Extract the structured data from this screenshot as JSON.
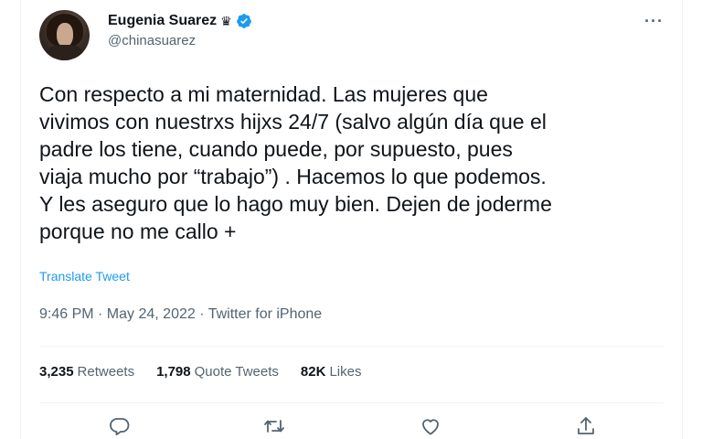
{
  "author": {
    "display_name": "Eugenia Suarez",
    "badge_glyph": "♛",
    "handle": "@chinasuarez"
  },
  "menu": {
    "more_glyph": "···"
  },
  "tweet": {
    "text": "Con respecto a mi maternidad. Las mujeres que\nvivimos con nuestrxs hijxs 24/7 (salvo algún día que el\npadre los tiene, cuando puede, por supuesto, pues\nviaja mucho por “trabajo”) . Hacemos lo que podemos.\nY les aseguro que lo hago muy bien. Dejen de joderme\nporque no me callo +",
    "translate_label": "Translate Tweet",
    "timestamp": "9:46 PM · May 24, 2022 · Twitter for iPhone"
  },
  "stats": {
    "retweets": {
      "count": "3,235",
      "label": "Retweets"
    },
    "quote_tweets": {
      "count": "1,798",
      "label": "Quote Tweets"
    },
    "likes": {
      "count": "82K",
      "label": "Likes"
    }
  },
  "icons": {
    "reply": "reply-icon",
    "retweet": "retweet-icon",
    "like": "heart-icon",
    "share": "share-icon",
    "verified": "verified-badge-icon"
  },
  "colors": {
    "accent": "#1d9bf0",
    "text": "#0f1419",
    "muted": "#536471",
    "border": "#eff3f4"
  }
}
